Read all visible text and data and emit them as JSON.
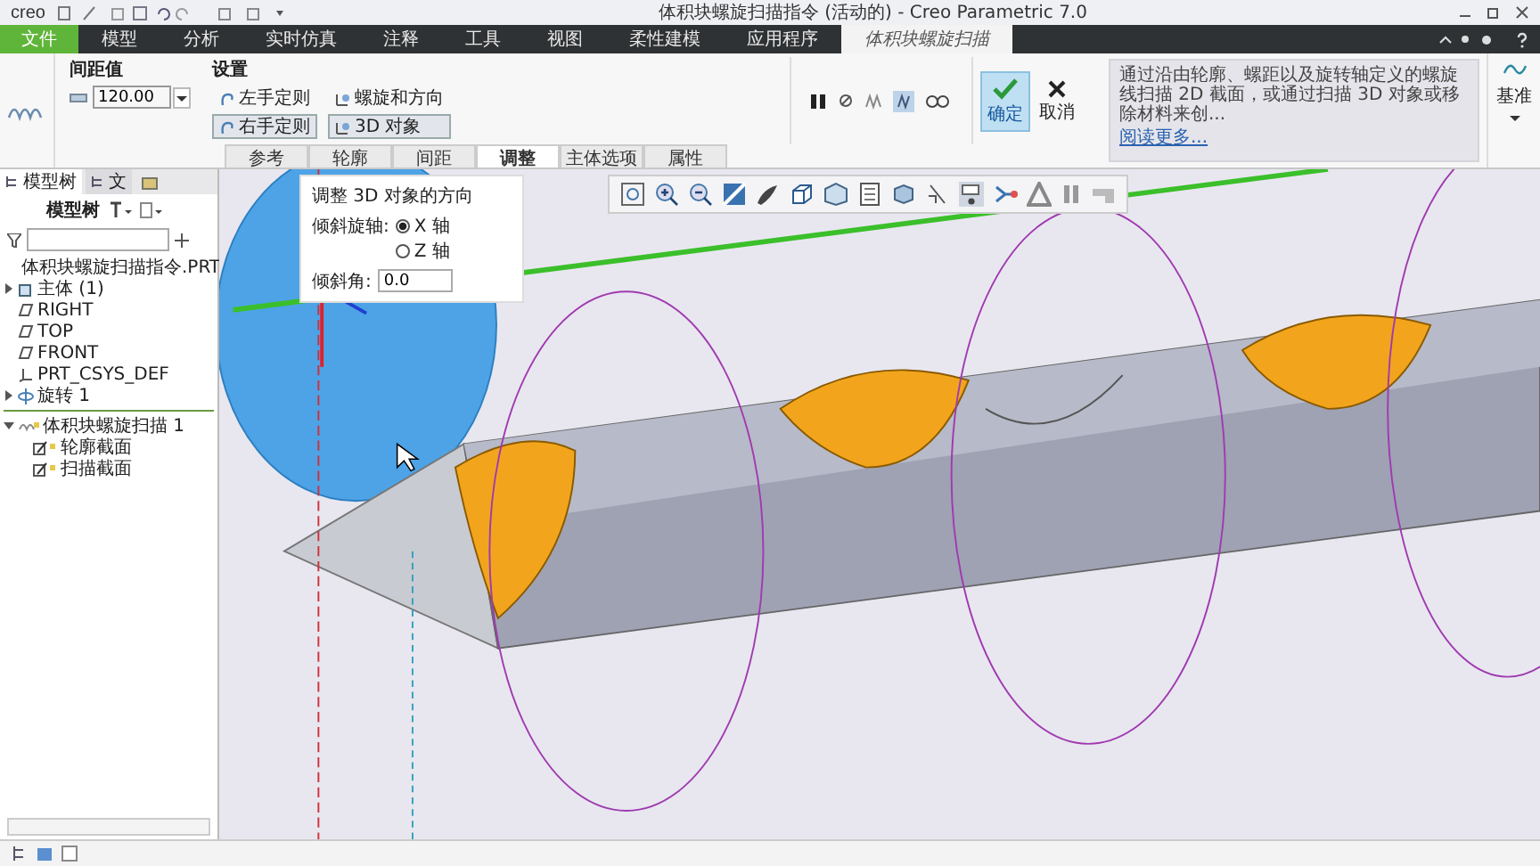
{
  "window": {
    "title": "体积块螺旋扫描指令 (活动的) - Creo Parametric 7.0",
    "logo": "creo"
  },
  "menu_tabs": [
    {
      "label": "文件",
      "kind": "file",
      "selected": false
    },
    {
      "label": "模型",
      "kind": "tab",
      "selected": false
    },
    {
      "label": "分析",
      "kind": "tab",
      "selected": false
    },
    {
      "label": "实时仿真",
      "kind": "tab",
      "selected": false
    },
    {
      "label": "注释",
      "kind": "tab",
      "selected": false
    },
    {
      "label": "工具",
      "kind": "tab",
      "selected": false
    },
    {
      "label": "视图",
      "kind": "tab",
      "selected": false
    },
    {
      "label": "柔性建模",
      "kind": "tab",
      "selected": false
    },
    {
      "label": "应用程序",
      "kind": "tab",
      "selected": false
    },
    {
      "label": "体积块螺旋扫描",
      "kind": "tool",
      "selected": true
    }
  ],
  "ribbon": {
    "pitch": {
      "label": "间距值",
      "value": "120.00"
    },
    "settings": {
      "label": "设置",
      "handedness": [
        {
          "label": "左手定则",
          "selected": false
        },
        {
          "label": "右手定则",
          "selected": true
        }
      ],
      "modes": [
        {
          "label": "螺旋和方向",
          "selected": false
        },
        {
          "label": "3D 对象",
          "selected": true
        }
      ]
    },
    "panel_tabs": [
      {
        "label": "参考",
        "selected": false
      },
      {
        "label": "轮廓",
        "selected": false
      },
      {
        "label": "间距",
        "selected": false
      },
      {
        "label": "调整",
        "selected": true
      },
      {
        "label": "主体选项",
        "selected": false
      },
      {
        "label": "属性",
        "selected": false
      }
    ],
    "ok": "确定",
    "cancel": "取消",
    "help": {
      "text": "通过沿由轮廓、螺距以及旋转轴定义的螺旋线扫描 2D 截面，或通过扫描 3D 对象或移除材料来创...",
      "link": "阅读更多..."
    },
    "datum": "基准"
  },
  "model_tree": {
    "tabs": [
      {
        "label": "模型树",
        "selected": true
      },
      {
        "label": "文",
        "selected": false
      }
    ],
    "header": "模型树",
    "items": [
      {
        "label": "体积块螺旋扫描指令.PRT",
        "kind": "part"
      },
      {
        "label": "主体 (1)",
        "kind": "body",
        "expanded": false
      },
      {
        "label": "RIGHT",
        "kind": "plane"
      },
      {
        "label": "TOP",
        "kind": "plane"
      },
      {
        "label": "FRONT",
        "kind": "plane"
      },
      {
        "label": "PRT_CSYS_DEF",
        "kind": "csys"
      },
      {
        "label": "旋转 1",
        "kind": "revolve",
        "expanded": false
      },
      {
        "label": "体积块螺旋扫描 1",
        "kind": "sweep",
        "expanded": true,
        "children": [
          {
            "label": "轮廓截面",
            "kind": "sketch"
          },
          {
            "label": "扫描截面",
            "kind": "sketch"
          }
        ]
      }
    ]
  },
  "adjust_panel": {
    "title": "调整 3D 对象的方向",
    "axis_label": "倾斜旋轴:",
    "axes": [
      {
        "label": "X 轴",
        "selected": true
      },
      {
        "label": "Z 轴",
        "selected": false
      }
    ],
    "angle_label": "倾斜角:",
    "angle": "0.0"
  }
}
